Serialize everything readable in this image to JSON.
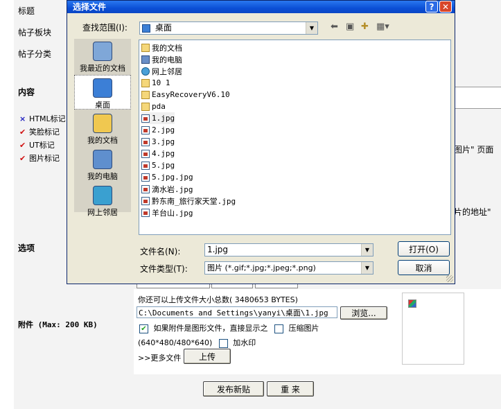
{
  "form": {
    "title_label": "标题",
    "board_label": "帖子板块",
    "category_label": "帖子分类",
    "content_label": "内容",
    "options_label": "选项",
    "attach_label": "附件 (Max: 200 KB)",
    "flags": [
      {
        "mark": "×",
        "text": "HTML标记",
        "color": "#2020c0"
      },
      {
        "mark": "✔",
        "text": "笑脸标记",
        "color": "#d01010"
      },
      {
        "mark": "✔",
        "text": "UT标记",
        "color": "#d01010"
      },
      {
        "mark": "✔",
        "text": "图片标记",
        "color": "#d01010"
      }
    ],
    "hint_right_1": "图片\" 页面",
    "hint_right_2": "片的地址\"",
    "upload": {
      "limit_text": "你还可以上传文件大小总数( 3480653 BYTES)",
      "path_value": "C:\\Documents and Settings\\yanyi\\桌面\\1.jpg",
      "browse_label": "浏览...",
      "direct_show_label": "如果附件是图形文件，直接显示之",
      "compress_label": "压缩图片",
      "size_text": "(640*480/480*640)",
      "watermark_label": "加水印",
      "more_files": ">>更多文件",
      "upload_label": "上传"
    },
    "publish_label": "发布新贴",
    "reset_label": "重 来"
  },
  "dialog": {
    "title": "选择文件",
    "help_glyph": "?",
    "close_glyph": "✕",
    "lookin_label": "查找范围(I):",
    "lookin_value": "桌面",
    "places": [
      {
        "label": "我最近的文档",
        "icon": "recent-documents-icon"
      },
      {
        "label": "桌面",
        "icon": "desktop-icon"
      },
      {
        "label": "我的文档",
        "icon": "my-documents-icon"
      },
      {
        "label": "我的电脑",
        "icon": "my-computer-icon"
      },
      {
        "label": "网上邻居",
        "icon": "network-places-icon"
      }
    ],
    "files": [
      {
        "name": "我的文档",
        "kind": "folder"
      },
      {
        "name": "我的电脑",
        "kind": "pc"
      },
      {
        "name": "网上邻居",
        "kind": "net"
      },
      {
        "name": "10 1",
        "kind": "folder"
      },
      {
        "name": "EasyRecoveryV6.10",
        "kind": "folder"
      },
      {
        "name": "pda",
        "kind": "folder"
      },
      {
        "name": "1.jpg",
        "kind": "jpg"
      },
      {
        "name": "2.jpg",
        "kind": "jpg"
      },
      {
        "name": "3.jpg",
        "kind": "jpg"
      },
      {
        "name": "4.jpg",
        "kind": "jpg"
      },
      {
        "name": "5.jpg",
        "kind": "jpg"
      },
      {
        "name": "5.jpg.jpg",
        "kind": "jpg"
      },
      {
        "name": "滴水岩.jpg",
        "kind": "jpg"
      },
      {
        "name": "黔东南_旅行家天堂.jpg",
        "kind": "jpg"
      },
      {
        "name": "羊台山.jpg",
        "kind": "jpg"
      }
    ],
    "filename_label": "文件名(N):",
    "filename_value": "1.jpg",
    "filetype_label": "文件类型(T):",
    "filetype_value": "图片 (*.gif;*.jpg;*.jpeg;*.png)",
    "open_label": "打开(O)",
    "cancel_label": "取消"
  }
}
